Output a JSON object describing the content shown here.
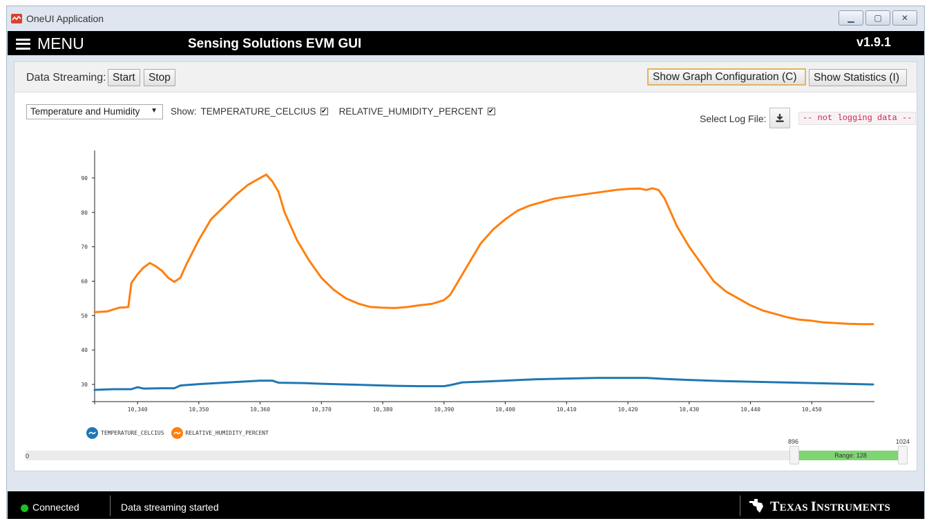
{
  "window": {
    "title": "OneUI Application"
  },
  "header": {
    "menu_label": "MENU",
    "app_title": "Sensing Solutions EVM GUI",
    "version": "v1.9.1"
  },
  "toolbar": {
    "data_streaming_label": "Data Streaming:",
    "start_label": "Start",
    "stop_label": "Stop",
    "graph_config_label": "Show Graph Configuration (C)",
    "statistics_label": "Show Statistics (I)"
  },
  "controls": {
    "dataset_select": {
      "selected": "Temperature and Humidity"
    },
    "show_label": "Show:",
    "checkboxes": [
      {
        "label": "TEMPERATURE_CELCIUS",
        "checked": true
      },
      {
        "label": "RELATIVE_HUMIDITY_PERCENT",
        "checked": true
      }
    ],
    "log_file_label": "Select Log File:",
    "log_status": "-- not logging data --"
  },
  "chart_data": {
    "type": "line",
    "title": "",
    "xlabel": "",
    "ylabel": "",
    "xlim": [
      10333,
      10460
    ],
    "ylim": [
      25,
      98
    ],
    "x_ticks": [
      "10,340",
      "10,350",
      "10,360",
      "10,370",
      "10,380",
      "10,390",
      "10,400",
      "10,410",
      "10,420",
      "10,430",
      "10,440",
      "10,450"
    ],
    "x_tick_values": [
      10340,
      10350,
      10360,
      10370,
      10380,
      10390,
      10400,
      10410,
      10420,
      10430,
      10440,
      10450
    ],
    "y_ticks": [
      "30",
      "40",
      "50",
      "60",
      "70",
      "80",
      "90"
    ],
    "y_tick_values": [
      30,
      40,
      50,
      60,
      70,
      80,
      90
    ],
    "legend_position": "bottom-left",
    "series": [
      {
        "name": "TEMPERATURE_CELCIUS",
        "color": "#1f77b4",
        "points": [
          [
            10333,
            28.4
          ],
          [
            10336,
            28.6
          ],
          [
            10339,
            28.6
          ],
          [
            10340,
            29.2
          ],
          [
            10341,
            28.8
          ],
          [
            10344,
            28.9
          ],
          [
            10346,
            28.9
          ],
          [
            10347,
            29.7
          ],
          [
            10350,
            30.1
          ],
          [
            10354,
            30.5
          ],
          [
            10357,
            30.8
          ],
          [
            10360,
            31.1
          ],
          [
            10362,
            31.1
          ],
          [
            10363,
            30.5
          ],
          [
            10367,
            30.4
          ],
          [
            10370,
            30.2
          ],
          [
            10374,
            30.0
          ],
          [
            10378,
            29.8
          ],
          [
            10382,
            29.6
          ],
          [
            10386,
            29.5
          ],
          [
            10390,
            29.5
          ],
          [
            10391,
            29.8
          ],
          [
            10393,
            30.6
          ],
          [
            10396,
            30.8
          ],
          [
            10400,
            31.1
          ],
          [
            10405,
            31.5
          ],
          [
            10410,
            31.7
          ],
          [
            10415,
            31.9
          ],
          [
            10420,
            31.9
          ],
          [
            10423,
            31.9
          ],
          [
            10426,
            31.6
          ],
          [
            10430,
            31.3
          ],
          [
            10435,
            31.0
          ],
          [
            10440,
            30.8
          ],
          [
            10445,
            30.6
          ],
          [
            10450,
            30.4
          ],
          [
            10455,
            30.2
          ],
          [
            10460,
            30.0
          ]
        ]
      },
      {
        "name": "RELATIVE_HUMIDITY_PERCENT",
        "color": "#ff7f0e",
        "points": [
          [
            10333,
            51
          ],
          [
            10335,
            51.2
          ],
          [
            10337,
            52.3
          ],
          [
            10338,
            52.4
          ],
          [
            10338.5,
            52.5
          ],
          [
            10339,
            59.5
          ],
          [
            10340,
            62
          ],
          [
            10341,
            64
          ],
          [
            10342,
            65.3
          ],
          [
            10343,
            64.3
          ],
          [
            10344,
            63
          ],
          [
            10345,
            61
          ],
          [
            10346,
            59.8
          ],
          [
            10347,
            61
          ],
          [
            10348,
            65
          ],
          [
            10350,
            72
          ],
          [
            10352,
            78
          ],
          [
            10354,
            81.5
          ],
          [
            10356,
            85
          ],
          [
            10358,
            88
          ],
          [
            10360,
            90
          ],
          [
            10361,
            91
          ],
          [
            10362,
            89
          ],
          [
            10363,
            86
          ],
          [
            10364,
            80
          ],
          [
            10366,
            72
          ],
          [
            10368,
            66
          ],
          [
            10370,
            61
          ],
          [
            10372,
            57.5
          ],
          [
            10374,
            55
          ],
          [
            10376,
            53.5
          ],
          [
            10378,
            52.5
          ],
          [
            10380,
            52.3
          ],
          [
            10382,
            52.2
          ],
          [
            10384,
            52.5
          ],
          [
            10386,
            53
          ],
          [
            10388,
            53.4
          ],
          [
            10390,
            54.5
          ],
          [
            10391,
            56
          ],
          [
            10392,
            59
          ],
          [
            10394,
            65
          ],
          [
            10396,
            71
          ],
          [
            10398,
            75
          ],
          [
            10400,
            78
          ],
          [
            10402,
            80.5
          ],
          [
            10404,
            82
          ],
          [
            10406,
            83
          ],
          [
            10408,
            84
          ],
          [
            10410,
            84.5
          ],
          [
            10412,
            85
          ],
          [
            10414,
            85.5
          ],
          [
            10416,
            86
          ],
          [
            10418,
            86.5
          ],
          [
            10420,
            86.8
          ],
          [
            10422,
            86.9
          ],
          [
            10423,
            86.5
          ],
          [
            10424,
            87
          ],
          [
            10425,
            86.5
          ],
          [
            10426,
            84
          ],
          [
            10428,
            76
          ],
          [
            10430,
            70
          ],
          [
            10432,
            65
          ],
          [
            10434,
            60
          ],
          [
            10436,
            57
          ],
          [
            10438,
            55
          ],
          [
            10440,
            53
          ],
          [
            10442,
            51.5
          ],
          [
            10444,
            50.5
          ],
          [
            10446,
            49.5
          ],
          [
            10448,
            48.8
          ],
          [
            10450,
            48.5
          ],
          [
            10452,
            48
          ],
          [
            10454,
            47.8
          ],
          [
            10456,
            47.6
          ],
          [
            10458,
            47.5
          ],
          [
            10460,
            47.5
          ]
        ]
      }
    ]
  },
  "range_slider": {
    "min_label": "0",
    "low": 896,
    "high": 1024,
    "low_label": "896",
    "high_label": "1024",
    "range_text": "Range: 128"
  },
  "status": {
    "connection": "Connected",
    "message": "Data streaming started",
    "brand": "Texas Instruments"
  }
}
